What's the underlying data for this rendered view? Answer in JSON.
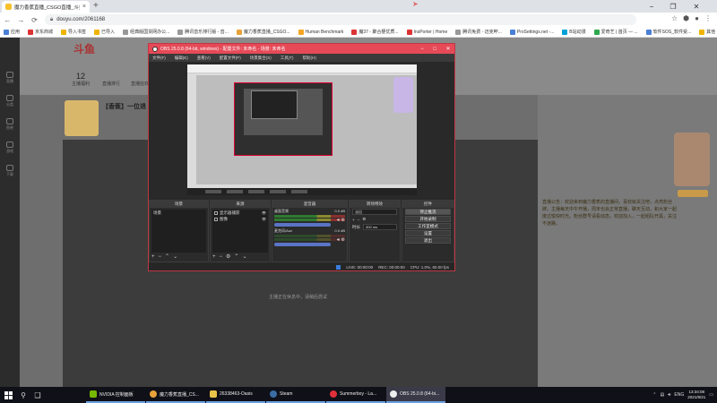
{
  "browser": {
    "tab_title": "魔力香蕉直播_CSGO直播_斗鱼",
    "url": "douyu.com/2061168",
    "bookmarks": [
      "应用",
      "京东商城",
      "导入书签",
      "已导入",
      "经典版国货网办公...",
      "腾讯音乐排行版 - 音...",
      "魔力香蕉直播_CSGO...",
      "Human Benchmark",
      "魔37 - 聚合梗优质...",
      "InsPorter | Home",
      "腾讯免费 - 迈克哔...",
      "ProSettings.net -...",
      "B站动漫",
      "爱奇艺 | 首页 — ...",
      "软件SOS_软件受..."
    ],
    "more_bookmarks": "其他"
  },
  "page": {
    "logo": "斗鱼",
    "stats": [
      {
        "value": "12",
        "label": "主播福利"
      },
      {
        "value": "",
        "label": "直播排行"
      },
      {
        "value": "",
        "label": "直播狂欢"
      }
    ],
    "streamer_title": "【香蕉】一位退",
    "player_status": "主播正在休息中，请稍后尝试",
    "right_text": "直播公告：欢迎来到魔力香蕉的直播间，喜欢就关注吧，点亮粉丝牌，主播每天中午开播，周末也会正常直播，聊天互动，和大家一起度过愉快时光。粉丝群号请看动态，欢迎加入，一起组队开黑，关注不迷路。"
  },
  "leftnav": [
    "直播",
    "分类",
    "鱼吧",
    "游戏",
    "下载"
  ],
  "obs": {
    "title": "OBS 25.0.8 (64-bit, windows) - 配置文件: 未命名 - 场景: 未命名",
    "menu": [
      "文件(F)",
      "编辑(E)",
      "查看(V)",
      "配置文件(P)",
      "场景集合(S)",
      "工具(T)",
      "帮助(H)"
    ],
    "docks": {
      "scenes_title": "场景",
      "scenes": [
        "场景"
      ],
      "sources_title": "来源",
      "sources": [
        "显示器捕获",
        "图像"
      ],
      "mixer_title": "混音器",
      "mixer": [
        {
          "name": "桌面音频",
          "db": "0.0 dB"
        },
        {
          "name": "麦克风/Aux",
          "db": "0.0 dB"
        }
      ],
      "transition_title": "转场特效",
      "transition_value": "淡出",
      "duration_label": "时长",
      "duration_value": "300 ms",
      "controls_title": "控件",
      "controls": [
        "停止推流",
        "开始录制",
        "工作室模式",
        "设置",
        "退出"
      ]
    },
    "status": [
      "LIVE: 00:00:00",
      "REC: 00:00:00",
      "CPU: 1.0%, 60.00 fps"
    ]
  },
  "taskbar": {
    "items": [
      {
        "label": "NVIDIA 控制面板",
        "color": "#76b900"
      },
      {
        "label": "魔力香蕉直播_CS...",
        "color": "#e8a23a"
      },
      {
        "label": "26338463-Oasis",
        "color": "#e8c34a"
      },
      {
        "label": "Steam",
        "color": "#1b2838"
      },
      {
        "label": "Summerboy - La...",
        "color": "#e0303a"
      },
      {
        "label": "OBS 25.0.8 (64-bi...",
        "color": "#302e31"
      }
    ],
    "lang": "ENG",
    "time": "13:34:08",
    "date": "2021/9/21"
  }
}
